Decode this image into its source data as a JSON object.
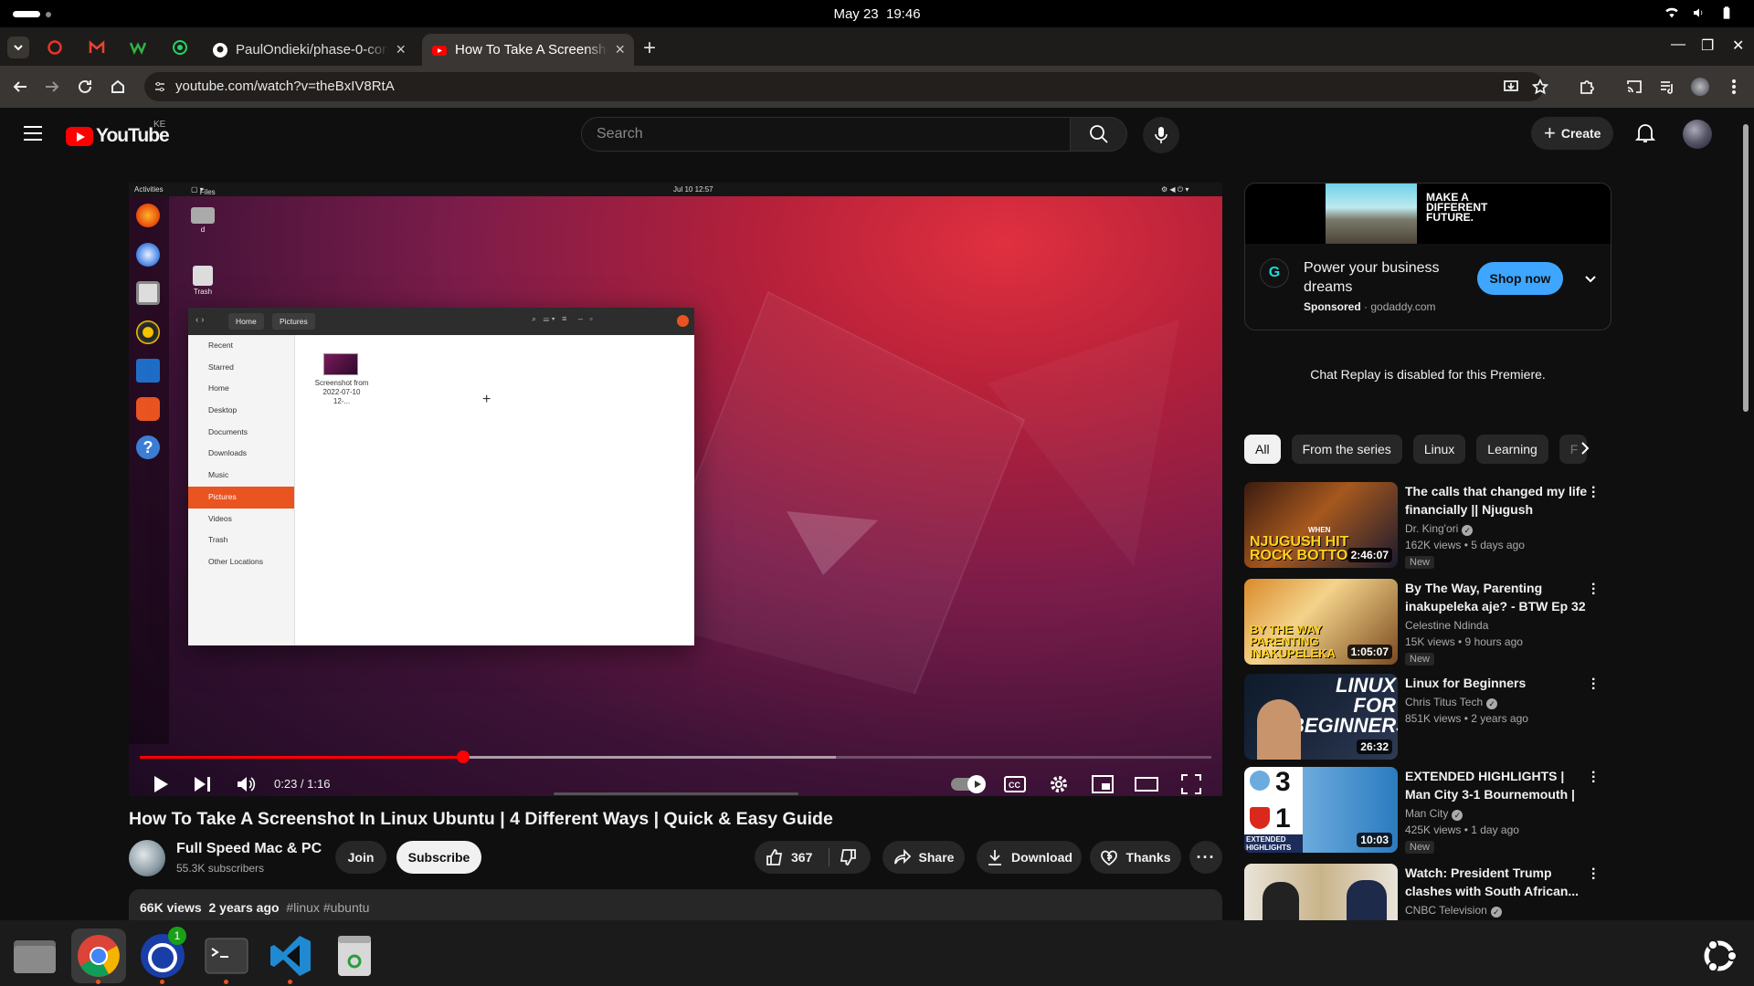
{
  "system": {
    "date": "May 23",
    "time": "19:46"
  },
  "browser": {
    "tabs": [
      {
        "title": "PaulOndieki/phase-0-con",
        "icon": "github-icon",
        "active": false
      },
      {
        "title": "How To Take A Screensho",
        "icon": "youtube-icon",
        "active": true
      }
    ],
    "url": "youtube.com/watch?v=theBxIV8RtA"
  },
  "youtube": {
    "logo_text": "YouTube",
    "country_code": "KE",
    "search_placeholder": "Search",
    "create_label": "Create"
  },
  "video_frame": {
    "activities": "Activities",
    "files": "Files",
    "datetime": "Jul 10  12:57",
    "desktop_items": [
      "d",
      "Trash"
    ],
    "breadcrumb": [
      "Home",
      "Pictures"
    ],
    "sidebar": [
      "Recent",
      "Starred",
      "Home",
      "Desktop",
      "Documents",
      "Downloads",
      "Music",
      "Pictures",
      "Videos",
      "Trash",
      "Other Locations"
    ],
    "selected": "Pictures",
    "file_caption": "Screenshot from 2022-07-10 12-..."
  },
  "player": {
    "time": "0:23 / 1:16",
    "played_fraction": 0.302,
    "buffered_fraction": 0.65,
    "autoplay_on": true
  },
  "video": {
    "title": "How To Take A Screenshot In Linux Ubuntu | 4 Different Ways | Quick & Easy Guide",
    "channel": "Full Speed Mac & PC",
    "subscribers": "55.3K subscribers",
    "join": "Join",
    "subscribe": "Subscribe",
    "likes": "367",
    "share": "Share",
    "download": "Download",
    "thanks": "Thanks",
    "views": "66K views",
    "age": "2 years ago",
    "tags": "#linux #ubuntu"
  },
  "ad": {
    "banner_text": "MAKE A DIFFERENT FUTURE.",
    "headline": "Power your business dreams",
    "sponsored": "Sponsored",
    "domain": "godaddy.com",
    "cta": "Shop now"
  },
  "chat_message": "Chat Replay is disabled for this Premiere.",
  "chips": [
    "All",
    "From the series",
    "Linux",
    "Learning",
    "F"
  ],
  "recommendations": [
    {
      "title": "The calls that changed my life financially || Njugush",
      "channel": "Dr. King'ori",
      "verified": true,
      "meta": "162K views  • 5 days ago",
      "badge": "New",
      "duration": "2:46:07",
      "thumb_text": "NJUGUSH HIT ROCK BOTTO",
      "thumb_tag": "WHEN"
    },
    {
      "title": "By The Way, Parenting inakupeleka aje? - BTW Ep 32",
      "channel": "Celestine Ndinda",
      "verified": false,
      "meta": "15K views  • 9 hours ago",
      "badge": "New",
      "duration": "1:05:07",
      "thumb_text": "BY THE WAY PARENTING INAKUPELEKA"
    },
    {
      "title": "Linux for Beginners",
      "channel": "Chris Titus Tech",
      "verified": true,
      "meta": "851K views  • 2 years ago",
      "badge": "",
      "duration": "26:32",
      "thumb_text": "LINUX FOR BEGINNERS"
    },
    {
      "title": "EXTENDED HIGHLIGHTS | Man City 3-1 Bournemouth | Kevin ...",
      "channel": "Man City",
      "verified": true,
      "meta": "425K views  • 1 day ago",
      "badge": "New",
      "duration": "10:03",
      "thumb_text": "EXTENDED HIGHLIGHTS",
      "score": [
        "3",
        "1"
      ]
    },
    {
      "title": "Watch: President Trump clashes with South African...",
      "channel": "CNBC Television",
      "verified": true,
      "meta": "",
      "badge": "",
      "duration": ""
    }
  ],
  "colors": {
    "accent_red": "#ff0000",
    "cta_blue": "#3ea6ff",
    "ubuntu_orange": "#e95420"
  }
}
